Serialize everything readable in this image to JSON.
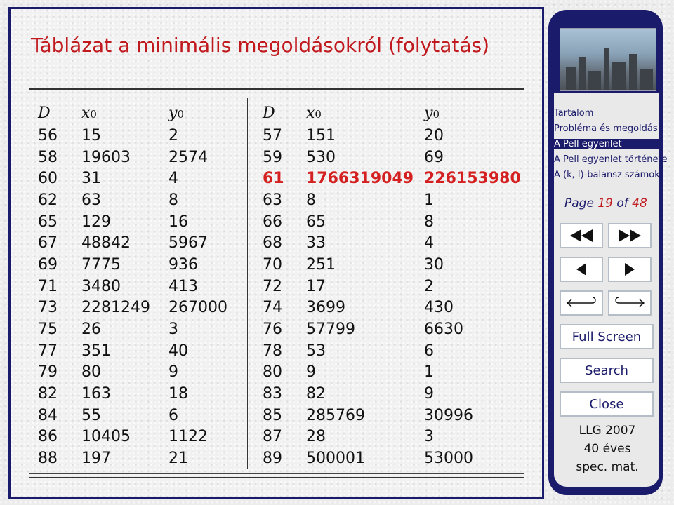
{
  "slide": {
    "title": "Táblázat a minimális megoldásokról (folytatás)",
    "left_table": {
      "headers": [
        "D",
        "x",
        "0",
        "y",
        "0"
      ],
      "rows": [
        [
          "56",
          "15",
          "2"
        ],
        [
          "58",
          "19603",
          "2574"
        ],
        [
          "60",
          "31",
          "4"
        ],
        [
          "62",
          "63",
          "8"
        ],
        [
          "65",
          "129",
          "16"
        ],
        [
          "67",
          "48842",
          "5967"
        ],
        [
          "69",
          "7775",
          "936"
        ],
        [
          "71",
          "3480",
          "413"
        ],
        [
          "73",
          "2281249",
          "267000"
        ],
        [
          "75",
          "26",
          "3"
        ],
        [
          "77",
          "351",
          "40"
        ],
        [
          "79",
          "80",
          "9"
        ],
        [
          "82",
          "163",
          "18"
        ],
        [
          "84",
          "55",
          "6"
        ],
        [
          "86",
          "10405",
          "1122"
        ],
        [
          "88",
          "197",
          "21"
        ]
      ]
    },
    "right_table": {
      "headers": [
        "D",
        "x",
        "0",
        "y",
        "0"
      ],
      "rows": [
        [
          "57",
          "151",
          "20"
        ],
        [
          "59",
          "530",
          "69"
        ],
        [
          "61",
          "1766319049",
          "226153980"
        ],
        [
          "63",
          "8",
          "1"
        ],
        [
          "66",
          "65",
          "8"
        ],
        [
          "68",
          "33",
          "4"
        ],
        [
          "70",
          "251",
          "30"
        ],
        [
          "72",
          "17",
          "2"
        ],
        [
          "74",
          "3699",
          "430"
        ],
        [
          "76",
          "57799",
          "6630"
        ],
        [
          "78",
          "53",
          "6"
        ],
        [
          "80",
          "9",
          "1"
        ],
        [
          "83",
          "82",
          "9"
        ],
        [
          "85",
          "285769",
          "30996"
        ],
        [
          "87",
          "28",
          "3"
        ],
        [
          "89",
          "500001",
          "53000"
        ]
      ],
      "highlight_row": 2
    }
  },
  "nav": {
    "toc": [
      "Tartalom",
      "Probléma és megoldás",
      "A Pell egyenlet",
      "A Pell egyenlet története",
      "A (k, l)-balansz számok"
    ],
    "active_index": 2,
    "page_label": "Page",
    "page_num": "19",
    "page_of": "of",
    "page_total": "48",
    "buttons": {
      "full_screen": "Full Screen",
      "search": "Search",
      "close": "Close"
    },
    "footer": [
      "LLG 2007",
      "40 éves",
      "spec. mat."
    ],
    "accent": "#1b1b6b",
    "highlight_color": "#c0191e"
  }
}
